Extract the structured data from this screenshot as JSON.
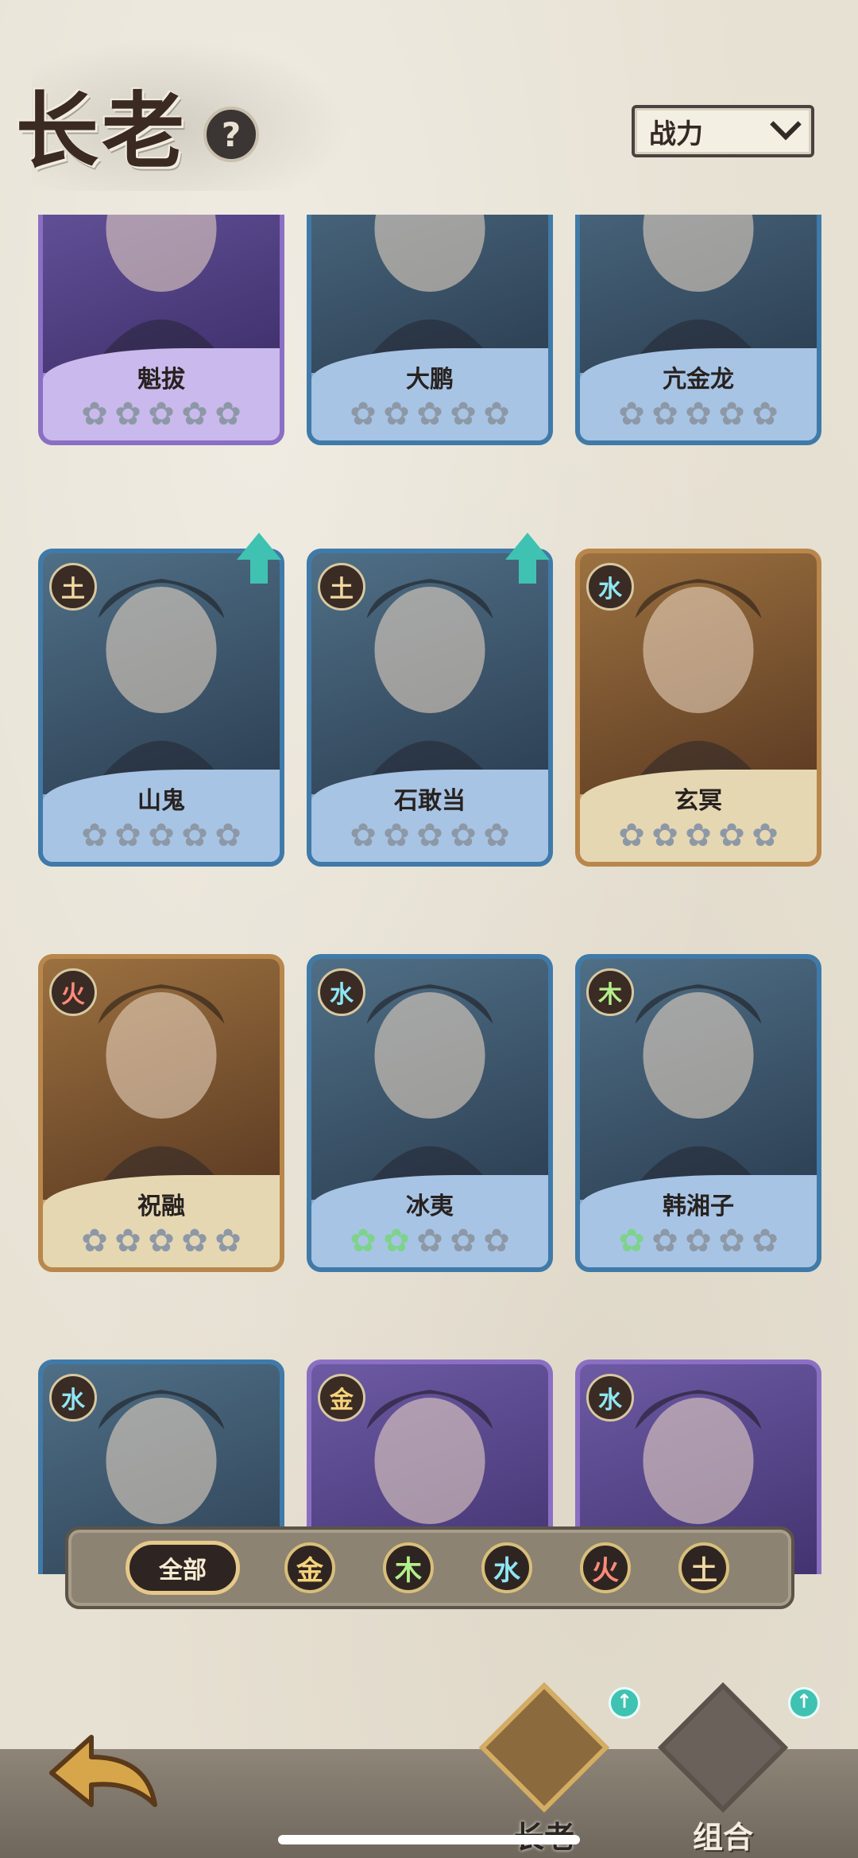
{
  "header": {
    "title": "长老",
    "help_label": "?",
    "sort": {
      "label": "战力"
    }
  },
  "cards": [
    {
      "name": "魁拔",
      "element": "",
      "stars_on": 0,
      "frame": "purple"
    },
    {
      "name": "大鹏",
      "element": "",
      "stars_on": 0,
      "frame": "blue"
    },
    {
      "name": "亢金龙",
      "element": "",
      "stars_on": 0,
      "frame": "blue"
    },
    {
      "name": "山鬼",
      "element": "土",
      "stars_on": 0,
      "frame": "blue",
      "upgrade": true
    },
    {
      "name": "石敢当",
      "element": "土",
      "stars_on": 0,
      "frame": "blue",
      "upgrade": true
    },
    {
      "name": "玄冥",
      "element": "水",
      "stars_on": 0,
      "frame": "gold"
    },
    {
      "name": "祝融",
      "element": "火",
      "stars_on": 0,
      "frame": "gold"
    },
    {
      "name": "冰夷",
      "element": "水",
      "stars_on": 2,
      "frame": "blue"
    },
    {
      "name": "韩湘子",
      "element": "木",
      "stars_on": 1,
      "frame": "blue"
    },
    {
      "name": "",
      "element": "水",
      "stars_on": 0,
      "frame": "blue"
    },
    {
      "name": "",
      "element": "金",
      "stars_on": 0,
      "frame": "purple"
    },
    {
      "name": "",
      "element": "水",
      "stars_on": 0,
      "frame": "purple"
    }
  ],
  "filters": {
    "all": "全部",
    "metal": "金",
    "wood": "木",
    "water": "水",
    "fire": "火",
    "earth": "土"
  },
  "nav": {
    "elders": "长老",
    "combo": "组合"
  }
}
